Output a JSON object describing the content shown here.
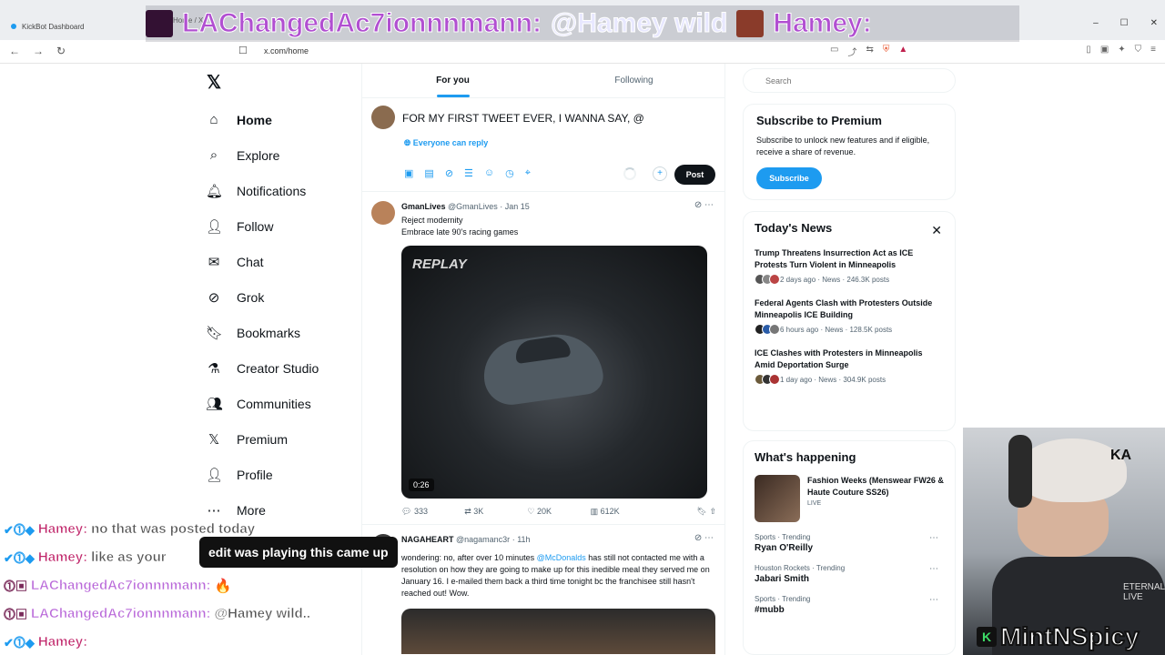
{
  "browser": {
    "tab_title": "KickBot Dashboard",
    "tab2_label": "Home / X",
    "url": "x.com/home"
  },
  "stream_overlay": {
    "user": "LAChangedAc7ionnnmann:",
    "message": "@Hamey wild",
    "user2": "Hamey:"
  },
  "x_nav": {
    "items": [
      {
        "label": "Home",
        "icon": "home-icon"
      },
      {
        "label": "Explore",
        "icon": "search-icon"
      },
      {
        "label": "Notifications",
        "icon": "bell-icon"
      },
      {
        "label": "Follow",
        "icon": "follow-icon"
      },
      {
        "label": "Chat",
        "icon": "mail-icon"
      },
      {
        "label": "Grok",
        "icon": "grok-icon"
      },
      {
        "label": "Bookmarks",
        "icon": "bookmark-icon"
      },
      {
        "label": "Creator Studio",
        "icon": "creator-icon"
      },
      {
        "label": "Communities",
        "icon": "communities-icon"
      },
      {
        "label": "Premium",
        "icon": "x-icon"
      },
      {
        "label": "Profile",
        "icon": "profile-icon"
      },
      {
        "label": "More",
        "icon": "more-icon"
      }
    ]
  },
  "feed": {
    "tabs": [
      "For you",
      "Following"
    ],
    "composer": {
      "text": "FOR MY FIRST TWEET EVER, I WANNA SAY, @",
      "reply_setting": "Everyone can reply",
      "post_label": "Post"
    },
    "tweets": [
      {
        "name": "GmanLives",
        "handle": "@GmanLives",
        "date": "· Jan 15",
        "line1": "Reject modernity",
        "line2": "Embrace late 90's racing games",
        "media_label": "REPLAY",
        "duration": "0:26",
        "replies": "333",
        "reposts": "3K",
        "likes": "20K",
        "views": "612K"
      },
      {
        "name": "NAGAHEART",
        "handle": "@nagamanc3r",
        "date": "· 11h",
        "text_a": "wondering: no, after over 10 minutes",
        "mention": "@McDonalds",
        "text_b": "has still not contacted me with a resolution on how they are going to make up for this inedible meal they served me on January 16. I e-mailed them back a third time tonight bc the franchisee still hasn't reached out! Wow."
      }
    ]
  },
  "right": {
    "search_placeholder": "Search",
    "premium": {
      "title": "Subscribe to Premium",
      "body": "Subscribe to unlock new features and if eligible, receive a share of revenue.",
      "button": "Subscribe"
    },
    "news": {
      "title": "Today's News",
      "items": [
        {
          "title": "Trump Threatens Insurrection Act as ICE Protests Turn Violent in Minneapolis",
          "meta": "2 days ago · News · 246.3K posts"
        },
        {
          "title": "Federal Agents Clash with Protesters Outside Minneapolis ICE Building",
          "meta": "6 hours ago · News · 128.5K posts"
        },
        {
          "title": "ICE Clashes with Protesters in Minneapolis Amid Deportation Surge",
          "meta": "1 day ago · News · 304.9K posts"
        }
      ]
    },
    "happening": {
      "title": "What's happening",
      "feature": {
        "title": "Fashion Weeks (Menswear FW26 & Haute Couture SS26)",
        "status": "LIVE"
      },
      "trends": [
        {
          "category": "Sports · Trending",
          "name": "Ryan O'Reilly"
        },
        {
          "category": "Houston Rockets · Trending",
          "name": "Jabari Smith"
        },
        {
          "category": "Sports · Trending",
          "name": "#mubb"
        }
      ]
    }
  },
  "chat_overlay": {
    "caption": "edit was playing this came up",
    "lines": [
      {
        "user": "Hamey:",
        "msg": "no that was posted today",
        "type": "hamey"
      },
      {
        "user": "Hamey:",
        "msg": "like as your",
        "type": "hamey"
      },
      {
        "user": "LAChangedAc7ionnnmann:",
        "msg": "🔥",
        "type": "la"
      },
      {
        "user": "LAChangedAc7ionnnmann:",
        "msg": "@Hamey wild..",
        "type": "la"
      },
      {
        "user": "Hamey:",
        "msg": "",
        "type": "hamey"
      }
    ]
  },
  "webcam": {
    "streamer": "MintNSpicy",
    "beanie": "KA",
    "shirt": "ETERNAL LIVE"
  }
}
